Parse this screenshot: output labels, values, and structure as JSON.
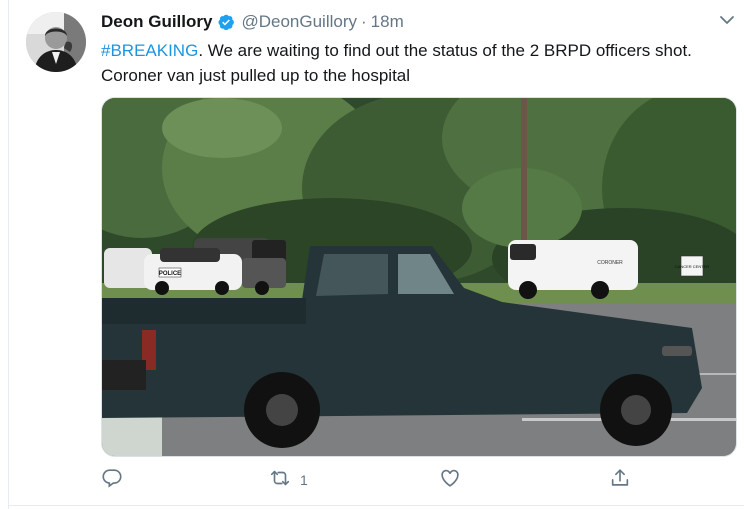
{
  "tweet": {
    "author_name": "Deon Guillory",
    "handle": "@DeonGuillory",
    "separator": "·",
    "time": "18m",
    "hashtag": "#BREAKING",
    "text": ". We are waiting to find out the status of the 2 BRPD officers shot. Coroner van just pulled up to the hospital",
    "media": {
      "police_car_label": "POLICE",
      "van_label": "CORONER",
      "sign_label": "CANCER CENTER"
    },
    "actions": {
      "reply_count": "",
      "retweet_count": "1",
      "like_count": "",
      "share_label": ""
    }
  },
  "colors": {
    "link": "#1b95e0",
    "secondary_text": "#657786",
    "verified": "#1da1f2"
  },
  "icons": [
    "verified-icon",
    "chevron-down-icon",
    "reply-icon",
    "retweet-icon",
    "like-icon",
    "share-icon"
  ]
}
